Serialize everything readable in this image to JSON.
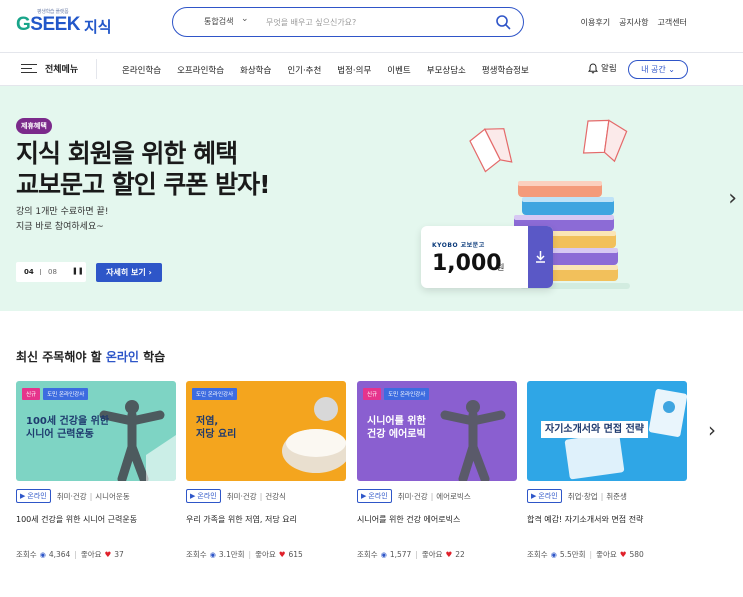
{
  "header": {
    "logo_small": "평생학습 플랫폼",
    "logo_main_g": "G",
    "logo_main_rest": "SEEK",
    "logo_sub": "지식",
    "search": {
      "category": "통합검색",
      "placeholder": "무엇을 배우고 싶으신가요?"
    },
    "links": [
      "이용후기",
      "공지사항",
      "고객센터"
    ]
  },
  "nav": {
    "all_menu": "전체메뉴",
    "items": [
      "온라인학습",
      "오프라인학습",
      "화상학습",
      "인기·추천",
      "법정·의무",
      "이벤트",
      "부모상담소",
      "평생학습정보"
    ],
    "alarm": "알림",
    "my_space": "내 공간 ⌄"
  },
  "banner": {
    "badge": "제휴혜택",
    "title_line1": "지식 회원을 위한 혜택",
    "title_line2": "교보문고 할인 쿠폰 받자!",
    "desc_line1": "강의 1개만 수료하면 끝!",
    "desc_line2": "지금 바로 참여하세요~",
    "page_current": "04",
    "page_total": "08",
    "detail_button": "자세히 보기 ›",
    "coupon_brand": "KYOBO 교보문고",
    "coupon_amount": "1,000",
    "coupon_unit": "원",
    "colors": {
      "background": "#e4f7ee",
      "accent": "#2e56c8",
      "badge": "#7b2a8b"
    }
  },
  "section": {
    "title_prefix": "최신 주목해야 할 ",
    "title_highlight": "온라인",
    "title_suffix": " 학습"
  },
  "cards": [
    {
      "tags": [
        "신규",
        "도민 온라인강사"
      ],
      "thumb_text_1": "100세 건강을 위한",
      "thumb_text_2": "시니어 근력운동",
      "thumb_color": "#7ed4c4",
      "type": "온라인",
      "category": "취미·건강",
      "subcategory": "시니어운동",
      "title": "100세 건강을 위한 시니어 근력운동",
      "views_label": "조회수",
      "views": "4,364",
      "likes_label": "좋아요",
      "likes": "37"
    },
    {
      "tags": [
        "도민 온라인강사"
      ],
      "thumb_text_1": "저염,",
      "thumb_text_2": "저당 요리",
      "thumb_color": "#f4a51e",
      "type": "온라인",
      "category": "취미·건강",
      "subcategory": "건강식",
      "title": "우리 가족을 위한 저염, 저당 요리",
      "views_label": "조회수",
      "views": "3.1만회",
      "likes_label": "좋아요",
      "likes": "615"
    },
    {
      "tags": [
        "신규",
        "도민 온라인강사"
      ],
      "thumb_text_1": "시니어를 위한",
      "thumb_text_2": "건강 에어로빅",
      "thumb_color": "#8a5fd0",
      "type": "온라인",
      "category": "취미·건강",
      "subcategory": "에어로빅스",
      "title": "시니어를 위한 건강 에어로빅스",
      "views_label": "조회수",
      "views": "1,577",
      "likes_label": "좋아요",
      "likes": "22"
    },
    {
      "tags": [],
      "thumb_text_1": "자기소개서와 면접 전략",
      "thumb_text_2": "",
      "thumb_color": "#2fa6e6",
      "type": "온라인",
      "category": "취업·창업",
      "subcategory": "취준생",
      "title": "합격 예감! 자기소개서와 면접 전략",
      "views_label": "조회수",
      "views": "5.5만회",
      "likes_label": "좋아요",
      "likes": "580"
    }
  ]
}
